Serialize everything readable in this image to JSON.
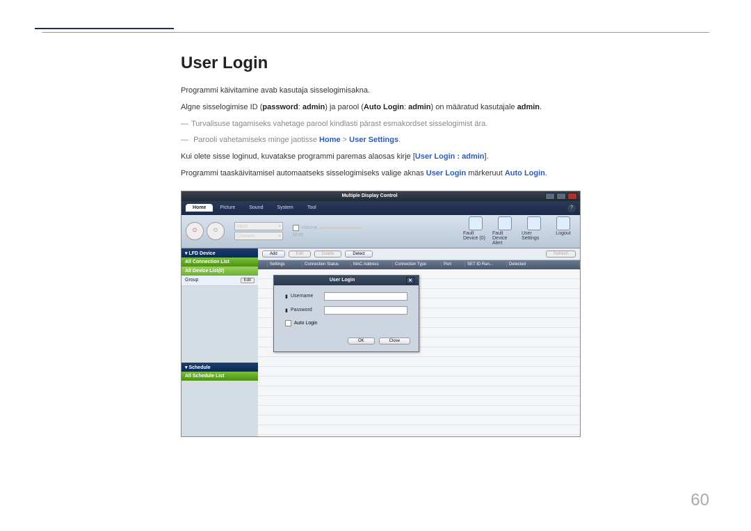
{
  "heading": "User Login",
  "p1": "Programmi käivitamine avab kasutaja sisselogimisakna.",
  "p2_a": "Algne sisselogimise ID (",
  "p2_b": "password",
  "p2_c": ": ",
  "p2_d": "admin",
  "p2_e": ") ja parool (",
  "p2_f": "Auto Login",
  "p2_g": ": ",
  "p2_h": "admin",
  "p2_i": ") on määratud kasutajale ",
  "p2_j": "admin",
  "p2_k": ".",
  "note1": "Turvalisuse tagamiseks vahetage parool kindlasti pärast esmakordset sisselogimist ära.",
  "note2_a": "Parooli vahetamiseks minge jaotisse ",
  "note2_home": "Home",
  "note2_sep": " > ",
  "note2_us": "User Settings",
  "note2_end": ".",
  "p3_a": "Kui olete sisse loginud, kuvatakse programmi paremas alaosas kirje [",
  "p3_b": "User Login : admin",
  "p3_c": "].",
  "p4_a": "Programmi taaskäivitamisel automaatseks sisselogimiseks valige aknas ",
  "p4_b": "User Login",
  "p4_c": " märkeruut ",
  "p4_d": "Auto Login",
  "p4_e": ".",
  "page_num": "60",
  "app": {
    "title": "Multiple Display Control",
    "menu": {
      "home": "Home",
      "picture": "Picture",
      "sound": "Sound",
      "system": "System",
      "tool": "Tool"
    },
    "help": "?",
    "combo": {
      "input": "Input",
      "channel": "Channel"
    },
    "slider": {
      "volume": "Volume",
      "mute": "Mute"
    },
    "tools": {
      "fd0": "Fault Device (0)",
      "fda": "Fault Device Alert",
      "us": "User Settings",
      "logout": "Logout"
    },
    "side": {
      "lfd": "LFD Device",
      "all_conn": "All Connection List",
      "all_dev": "All Device List(0)",
      "group": "Group",
      "edit": "Edit",
      "schedule": "Schedule",
      "all_sched": "All Schedule List"
    },
    "btns": {
      "add": "Add",
      "edit": "Edit",
      "delete": "Delete",
      "detect": "Detect",
      "refresh": "Refresh"
    },
    "cols": [
      "Settings",
      "Connection Status",
      "MAC Address",
      "Connection Type",
      "Port",
      "SET ID Ran...",
      "Detected"
    ],
    "dialog": {
      "title": "User Login",
      "username": "Username",
      "password": "Password",
      "auto": "Auto Login",
      "ok": "OK",
      "close": "Close"
    }
  }
}
